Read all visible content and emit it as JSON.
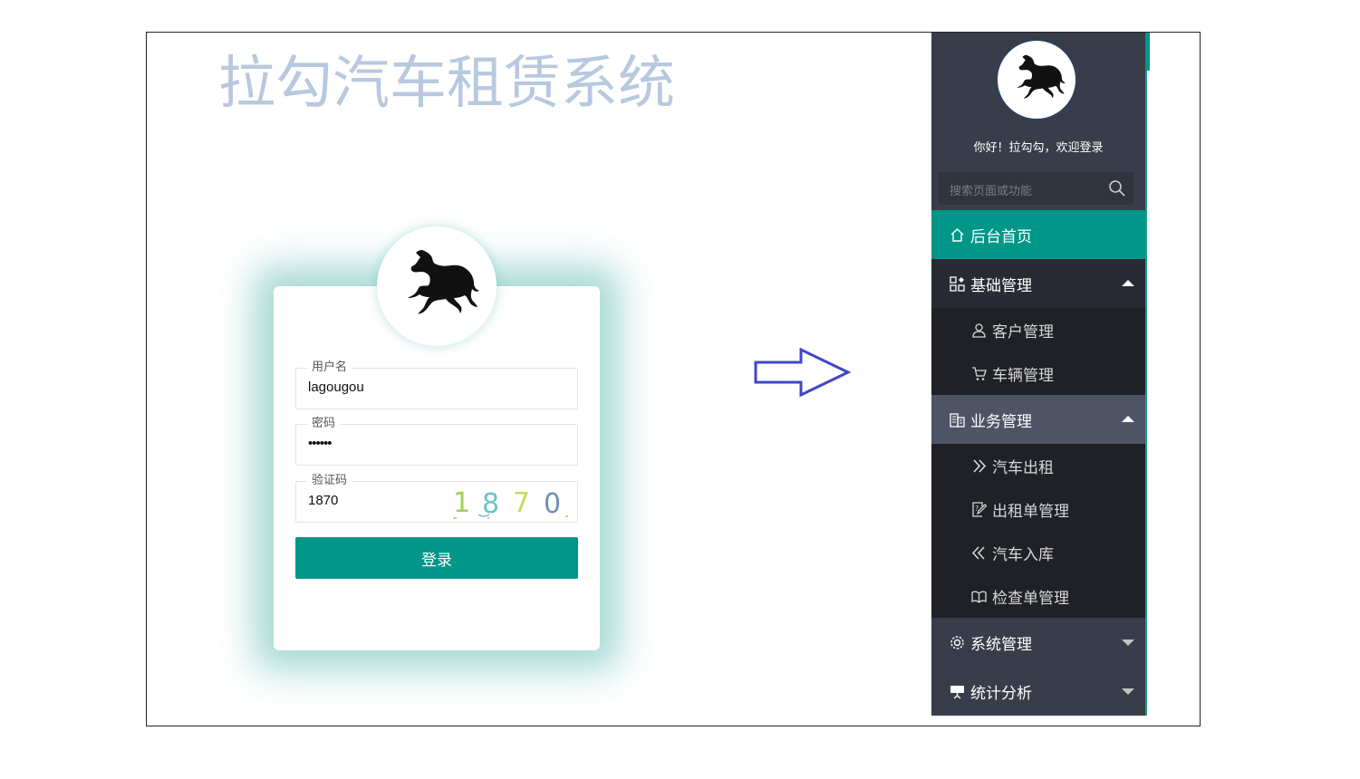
{
  "login": {
    "system_title": "拉勾汽车租赁系统",
    "username_label": "用户名",
    "username_value": "lagougou",
    "password_label": "密码",
    "password_value": "••••••",
    "captcha_label": "验证码",
    "captcha_value": "1870",
    "captcha_image_digits": [
      "1",
      "8",
      "7",
      "0"
    ],
    "login_button": "登录"
  },
  "sidebar": {
    "welcome": "你好！拉勾勾，欢迎登录",
    "search_placeholder": "搜索页面或功能",
    "home": "后台首页",
    "groups": [
      {
        "label": "基础管理",
        "expanded": true,
        "items": [
          "客户管理",
          "车辆管理"
        ]
      },
      {
        "label": "业务管理",
        "expanded": true,
        "items": [
          "汽车出租",
          "出租单管理",
          "汽车入库",
          "检查单管理"
        ]
      },
      {
        "label": "系统管理",
        "expanded": false,
        "items": []
      },
      {
        "label": "统计分析",
        "expanded": false,
        "items": []
      }
    ]
  },
  "colors": {
    "accent": "#009688",
    "sidebar_bg": "#393d49",
    "submenu_bg": "#1f2127",
    "title_color": "#b8c8df",
    "arrow": "#3f47c9"
  }
}
